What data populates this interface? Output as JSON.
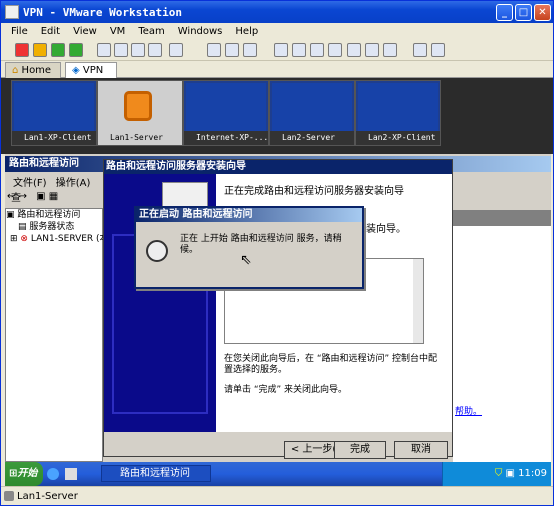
{
  "window": {
    "title": "VPN - VMware Workstation"
  },
  "menu": [
    "File",
    "Edit",
    "View",
    "VM",
    "Team",
    "Windows",
    "Help"
  ],
  "tabs": [
    {
      "label": "Home"
    },
    {
      "label": "VPN"
    }
  ],
  "thumbnails": [
    {
      "label": "Lan1-XP-Client"
    },
    {
      "label": "Lan1-Server"
    },
    {
      "label": "Internet-XP-..."
    },
    {
      "label": "Lan2-Server"
    },
    {
      "label": "Lan2-XP-Client"
    }
  ],
  "mmc": {
    "title": "路由和远程访问",
    "menu": [
      "文件(F)",
      "操作(A)",
      "查"
    ],
    "tree": [
      "路由和远程访问",
      "服务器状态",
      "LAN1-SERVER (本"
    ],
    "link": "帮助。"
  },
  "wizard": {
    "title": "路由和远程访问服务器安装向导",
    "heading": "正在完成路由和远程访问服务器安装向导",
    "line2": "装向导。",
    "closing": "在您关闭此向导后，在 “路由和远程访问” 控制台中配置选择的服务。",
    "finish_hint": "请单击 “完成” 来关闭此向导。",
    "back": "< 上一步(B)",
    "finish": "完成",
    "cancel": "取消"
  },
  "dialog": {
    "title": "正在启动 路由和远程访问",
    "message": "正在  上开始 路由和远程访问 服务，请稍候。"
  },
  "taskbar": {
    "start": "开始",
    "task": "路由和远程访问",
    "time": "11:09"
  },
  "status": {
    "text": "Lan1-Server"
  }
}
